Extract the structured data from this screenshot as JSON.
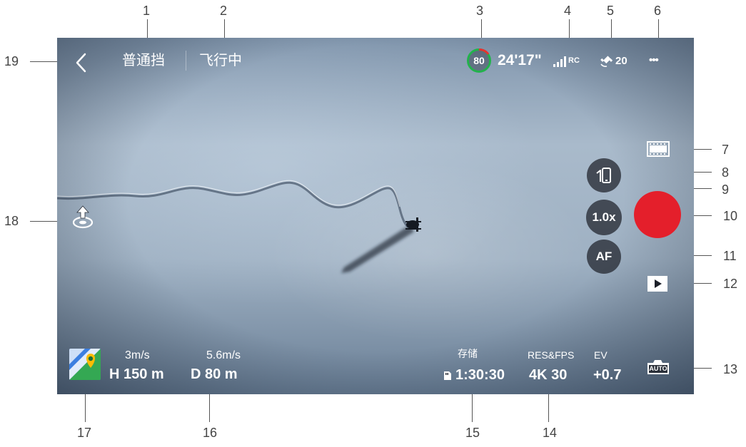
{
  "callouts": [
    "1",
    "2",
    "3",
    "4",
    "5",
    "6",
    "7",
    "8",
    "9",
    "10",
    "11",
    "12",
    "13",
    "14",
    "15",
    "16",
    "17",
    "18",
    "19"
  ],
  "topbar": {
    "flight_mode": "普通挡",
    "flight_status": "飞行中",
    "battery_percent": "80",
    "flight_time": "24'17\"",
    "rc_label": "RC",
    "gps_count": "20",
    "more": "•••"
  },
  "zoom": {
    "label": "1.0x"
  },
  "focus": {
    "label": "AF"
  },
  "telemetry": {
    "vertical_speed": "3m/s",
    "height": "H 150 m",
    "horizontal_speed": "5.6m/s",
    "distance": "D 80 m"
  },
  "camera_info": {
    "storage_label": "存储",
    "storage_value": "1:30:30",
    "resfps_label": "RES&FPS",
    "resfps_value": "4K 30",
    "ev_label": "EV",
    "ev_value": "+0.7",
    "auto_label": "AUTO"
  },
  "colors": {
    "record_red": "#e41f2b",
    "battery_green": "#22b24c",
    "battery_red": "#e8312f",
    "button_bg": "#2f333b"
  }
}
